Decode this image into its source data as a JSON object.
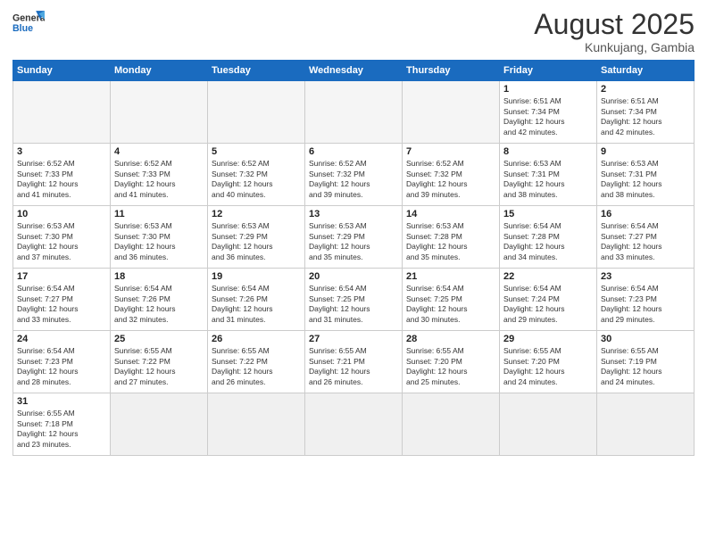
{
  "header": {
    "logo_general": "General",
    "logo_blue": "Blue",
    "main_title": "August 2025",
    "subtitle": "Kunkujang, Gambia"
  },
  "weekdays": [
    "Sunday",
    "Monday",
    "Tuesday",
    "Wednesday",
    "Thursday",
    "Friday",
    "Saturday"
  ],
  "weeks": [
    [
      {
        "day": "",
        "info": ""
      },
      {
        "day": "",
        "info": ""
      },
      {
        "day": "",
        "info": ""
      },
      {
        "day": "",
        "info": ""
      },
      {
        "day": "",
        "info": ""
      },
      {
        "day": "1",
        "info": "Sunrise: 6:51 AM\nSunset: 7:34 PM\nDaylight: 12 hours\nand 42 minutes."
      },
      {
        "day": "2",
        "info": "Sunrise: 6:51 AM\nSunset: 7:34 PM\nDaylight: 12 hours\nand 42 minutes."
      }
    ],
    [
      {
        "day": "3",
        "info": "Sunrise: 6:52 AM\nSunset: 7:33 PM\nDaylight: 12 hours\nand 41 minutes."
      },
      {
        "day": "4",
        "info": "Sunrise: 6:52 AM\nSunset: 7:33 PM\nDaylight: 12 hours\nand 41 minutes."
      },
      {
        "day": "5",
        "info": "Sunrise: 6:52 AM\nSunset: 7:32 PM\nDaylight: 12 hours\nand 40 minutes."
      },
      {
        "day": "6",
        "info": "Sunrise: 6:52 AM\nSunset: 7:32 PM\nDaylight: 12 hours\nand 39 minutes."
      },
      {
        "day": "7",
        "info": "Sunrise: 6:52 AM\nSunset: 7:32 PM\nDaylight: 12 hours\nand 39 minutes."
      },
      {
        "day": "8",
        "info": "Sunrise: 6:53 AM\nSunset: 7:31 PM\nDaylight: 12 hours\nand 38 minutes."
      },
      {
        "day": "9",
        "info": "Sunrise: 6:53 AM\nSunset: 7:31 PM\nDaylight: 12 hours\nand 38 minutes."
      }
    ],
    [
      {
        "day": "10",
        "info": "Sunrise: 6:53 AM\nSunset: 7:30 PM\nDaylight: 12 hours\nand 37 minutes."
      },
      {
        "day": "11",
        "info": "Sunrise: 6:53 AM\nSunset: 7:30 PM\nDaylight: 12 hours\nand 36 minutes."
      },
      {
        "day": "12",
        "info": "Sunrise: 6:53 AM\nSunset: 7:29 PM\nDaylight: 12 hours\nand 36 minutes."
      },
      {
        "day": "13",
        "info": "Sunrise: 6:53 AM\nSunset: 7:29 PM\nDaylight: 12 hours\nand 35 minutes."
      },
      {
        "day": "14",
        "info": "Sunrise: 6:53 AM\nSunset: 7:28 PM\nDaylight: 12 hours\nand 35 minutes."
      },
      {
        "day": "15",
        "info": "Sunrise: 6:54 AM\nSunset: 7:28 PM\nDaylight: 12 hours\nand 34 minutes."
      },
      {
        "day": "16",
        "info": "Sunrise: 6:54 AM\nSunset: 7:27 PM\nDaylight: 12 hours\nand 33 minutes."
      }
    ],
    [
      {
        "day": "17",
        "info": "Sunrise: 6:54 AM\nSunset: 7:27 PM\nDaylight: 12 hours\nand 33 minutes."
      },
      {
        "day": "18",
        "info": "Sunrise: 6:54 AM\nSunset: 7:26 PM\nDaylight: 12 hours\nand 32 minutes."
      },
      {
        "day": "19",
        "info": "Sunrise: 6:54 AM\nSunset: 7:26 PM\nDaylight: 12 hours\nand 31 minutes."
      },
      {
        "day": "20",
        "info": "Sunrise: 6:54 AM\nSunset: 7:25 PM\nDaylight: 12 hours\nand 31 minutes."
      },
      {
        "day": "21",
        "info": "Sunrise: 6:54 AM\nSunset: 7:25 PM\nDaylight: 12 hours\nand 30 minutes."
      },
      {
        "day": "22",
        "info": "Sunrise: 6:54 AM\nSunset: 7:24 PM\nDaylight: 12 hours\nand 29 minutes."
      },
      {
        "day": "23",
        "info": "Sunrise: 6:54 AM\nSunset: 7:23 PM\nDaylight: 12 hours\nand 29 minutes."
      }
    ],
    [
      {
        "day": "24",
        "info": "Sunrise: 6:54 AM\nSunset: 7:23 PM\nDaylight: 12 hours\nand 28 minutes."
      },
      {
        "day": "25",
        "info": "Sunrise: 6:55 AM\nSunset: 7:22 PM\nDaylight: 12 hours\nand 27 minutes."
      },
      {
        "day": "26",
        "info": "Sunrise: 6:55 AM\nSunset: 7:22 PM\nDaylight: 12 hours\nand 26 minutes."
      },
      {
        "day": "27",
        "info": "Sunrise: 6:55 AM\nSunset: 7:21 PM\nDaylight: 12 hours\nand 26 minutes."
      },
      {
        "day": "28",
        "info": "Sunrise: 6:55 AM\nSunset: 7:20 PM\nDaylight: 12 hours\nand 25 minutes."
      },
      {
        "day": "29",
        "info": "Sunrise: 6:55 AM\nSunset: 7:20 PM\nDaylight: 12 hours\nand 24 minutes."
      },
      {
        "day": "30",
        "info": "Sunrise: 6:55 AM\nSunset: 7:19 PM\nDaylight: 12 hours\nand 24 minutes."
      }
    ],
    [
      {
        "day": "31",
        "info": "Sunrise: 6:55 AM\nSunset: 7:18 PM\nDaylight: 12 hours\nand 23 minutes."
      },
      {
        "day": "",
        "info": ""
      },
      {
        "day": "",
        "info": ""
      },
      {
        "day": "",
        "info": ""
      },
      {
        "day": "",
        "info": ""
      },
      {
        "day": "",
        "info": ""
      },
      {
        "day": "",
        "info": ""
      }
    ]
  ]
}
